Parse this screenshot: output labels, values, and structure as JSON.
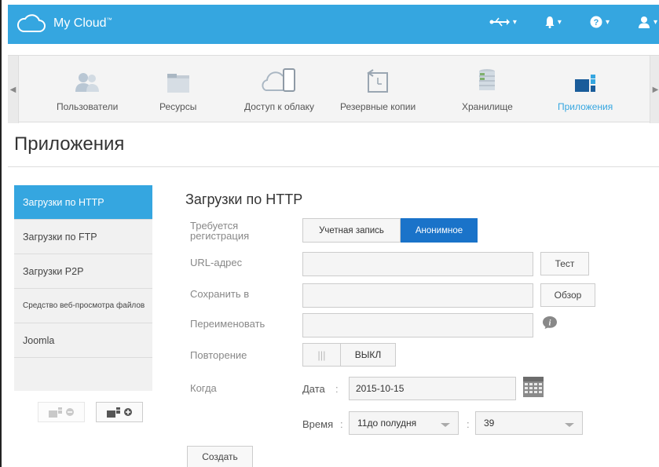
{
  "header": {
    "app_name": "My Cloud",
    "trademark": "™",
    "icons": [
      "usb-icon",
      "bell-icon",
      "help-icon",
      "user-icon"
    ]
  },
  "nav": {
    "items": [
      {
        "label": "Пользователи",
        "icon": "users-icon"
      },
      {
        "label": "Ресурсы",
        "icon": "folder-icon"
      },
      {
        "label": "Доступ к облаку",
        "icon": "cloud-device-icon"
      },
      {
        "label": "Резервные копии",
        "icon": "backup-icon"
      },
      {
        "label": "Хранилище",
        "icon": "storage-icon"
      },
      {
        "label": "Приложения",
        "icon": "apps-icon",
        "active": true
      }
    ]
  },
  "page": {
    "title": "Приложения"
  },
  "sidebar": {
    "items": [
      {
        "label": "Загрузки по HTTP",
        "active": true
      },
      {
        "label": "Загрузки по FTP"
      },
      {
        "label": "Загрузки P2P"
      },
      {
        "label": "Средство веб-просмотра файлов"
      },
      {
        "label": "Joomla"
      }
    ]
  },
  "form": {
    "title": "Загрузки по HTTP",
    "registration_label": "Требуется регистрация",
    "registration_options": [
      "Учетная запись",
      "Анонимное"
    ],
    "registration_selected": "Анонимное",
    "url_label": "URL-адрес",
    "url_value": "",
    "test_button": "Тест",
    "save_to_label": "Сохранить в",
    "save_to_value": "",
    "browse_button": "Обзор",
    "rename_label": "Переименовать",
    "rename_value": "",
    "repeat_label": "Повторение",
    "repeat_toggle_handle": "|||",
    "repeat_state": "ВЫКЛ",
    "when_label": "Когда",
    "date_label": "Дата",
    "date_value": "2015-10-15",
    "time_label": "Время",
    "hour_value": "11до полудня",
    "minute_value": "39",
    "create_button": "Создать"
  },
  "colors": {
    "accent": "#35a6e0",
    "selected_button": "#1a73c9"
  }
}
